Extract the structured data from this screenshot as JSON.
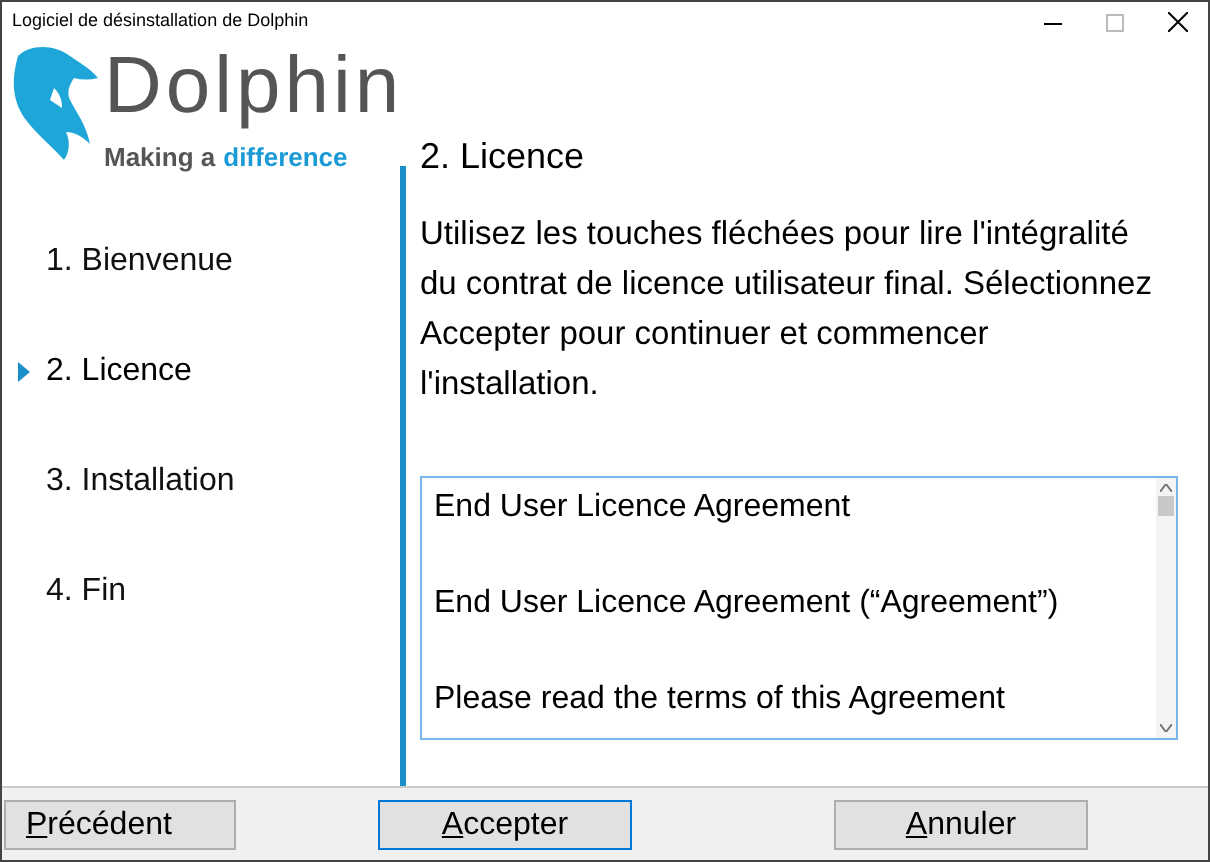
{
  "window": {
    "title": "Logiciel de désinstallation de Dolphin"
  },
  "logo": {
    "name": "Dolphin",
    "tagline": "Making a",
    "tagline_highlight": "difference"
  },
  "steps": [
    {
      "label": "1. Bienvenue",
      "selected": false
    },
    {
      "label": "2. Licence",
      "selected": true
    },
    {
      "label": "3. Installation",
      "selected": false
    },
    {
      "label": "4. Fin",
      "selected": false
    }
  ],
  "page": {
    "heading": "2. Licence",
    "instructions": "Utilisez les touches fléchées pour lire l'intégralité du contrat de licence utilisateur final. Sélectionnez Accepter pour continuer et commencer l'installation."
  },
  "licence_text": [
    "End User Licence Agreement",
    "End User Licence Agreement (“Agreement”)",
    "Please read the terms of this Agreement"
  ],
  "buttons": [
    {
      "label": "Précédent",
      "focused": false
    },
    {
      "label": "Accepter",
      "focused": true
    },
    {
      "label": "Annuler",
      "focused": false
    }
  ]
}
